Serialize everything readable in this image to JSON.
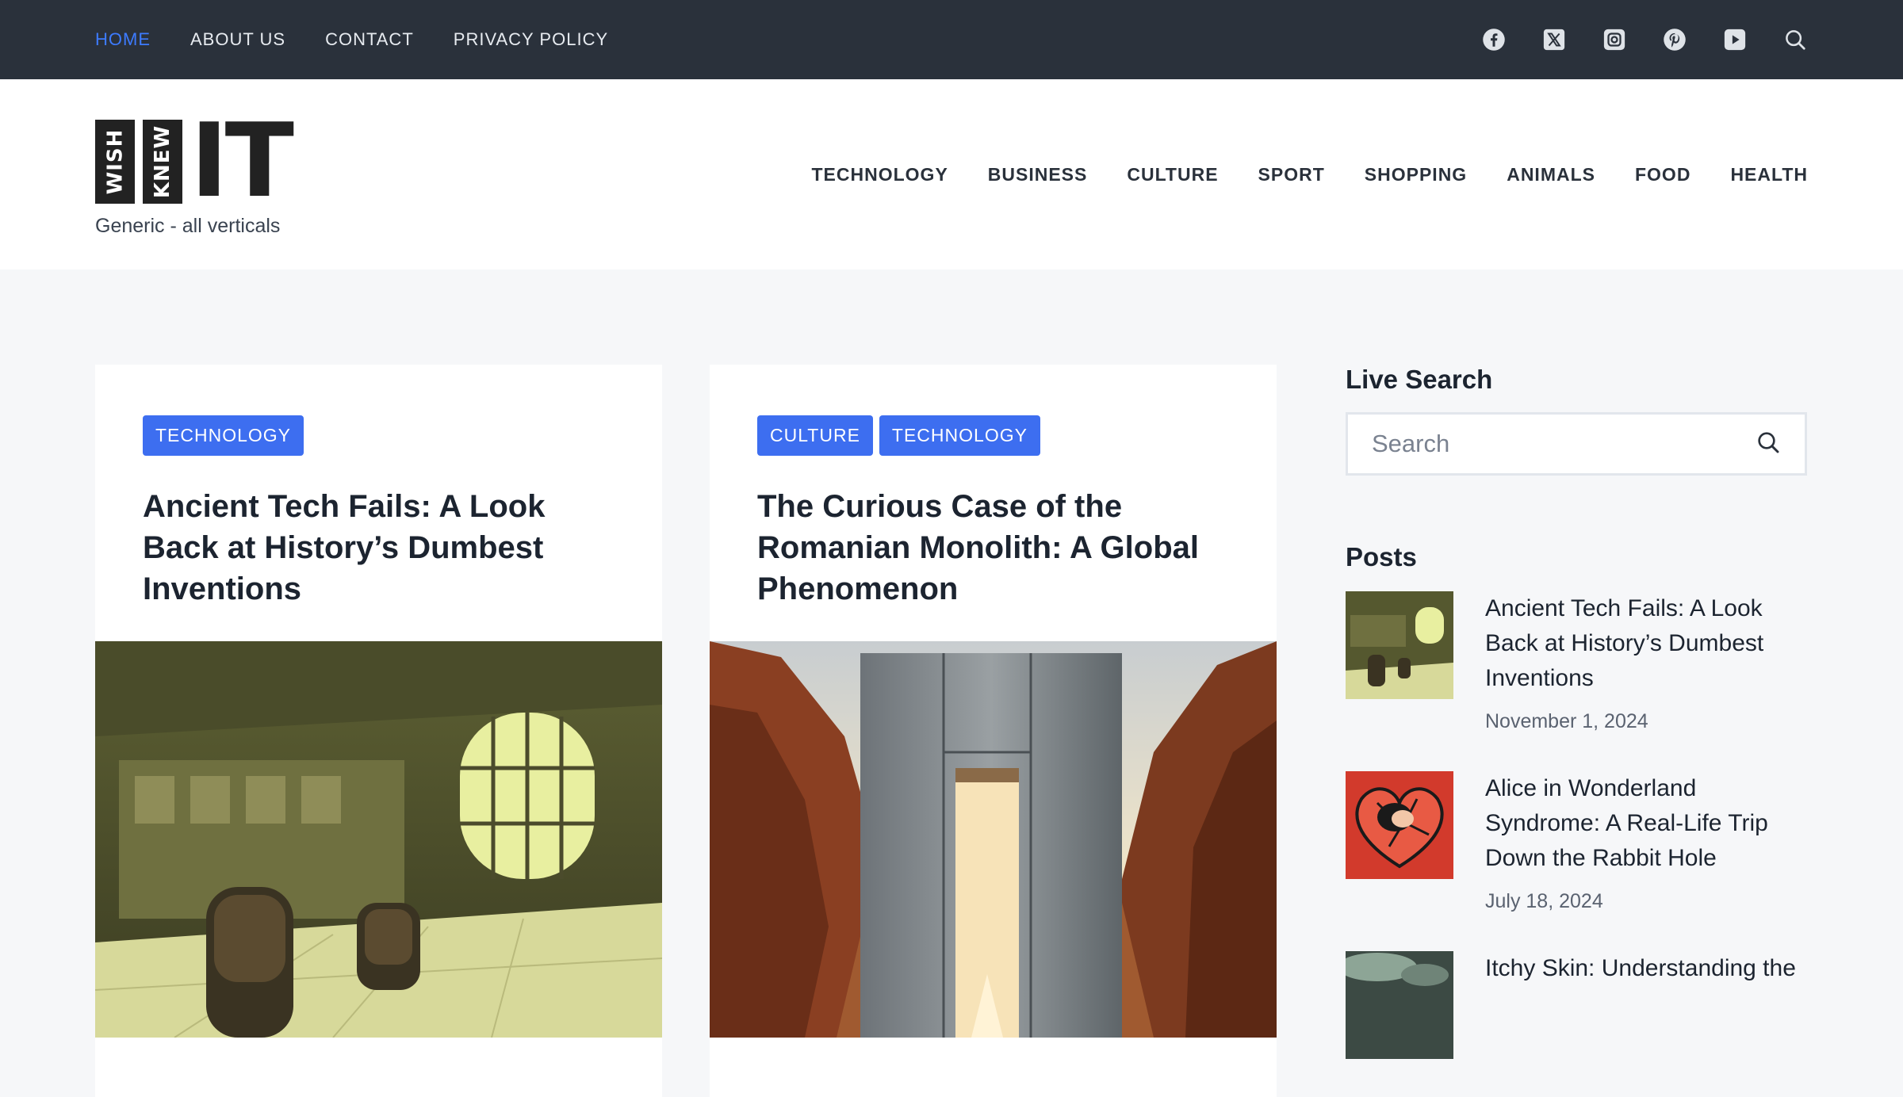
{
  "topbar": {
    "nav": [
      {
        "label": "HOME",
        "active": true
      },
      {
        "label": "ABOUT US",
        "active": false
      },
      {
        "label": "CONTACT",
        "active": false
      },
      {
        "label": "PRIVACY POLICY",
        "active": false
      }
    ],
    "social_icons": [
      "facebook-icon",
      "x-twitter-icon",
      "instagram-icon",
      "pinterest-icon",
      "youtube-icon",
      "search-icon"
    ]
  },
  "brand": {
    "logo_word1": "WISH",
    "logo_word2": "KNEW",
    "logo_word3": "IT",
    "tagline": "Generic - all verticals"
  },
  "main_nav": [
    "TECHNOLOGY",
    "BUSINESS",
    "CULTURE",
    "SPORT",
    "SHOPPING",
    "ANIMALS",
    "FOOD",
    "HEALTH"
  ],
  "articles": [
    {
      "tags": [
        "TECHNOLOGY"
      ],
      "title": "Ancient Tech Fails: A Look Back at History’s Dumbest Inventions"
    },
    {
      "tags": [
        "CULTURE",
        "TECHNOLOGY"
      ],
      "title": "The Curious Case of the Romanian Monolith: A Global Phenomenon"
    }
  ],
  "sidebar": {
    "live_search_heading": "Live Search",
    "search_placeholder": "Search",
    "posts_heading": "Posts",
    "posts": [
      {
        "title": "Ancient Tech Fails: A Look Back at History’s Dumbest Inventions",
        "date": "November 1, 2024"
      },
      {
        "title": "Alice in Wonderland Syndrome: A Real-Life Trip Down the Rabbit Hole",
        "date": "July 18, 2024"
      },
      {
        "title": "Itchy Skin: Understanding the",
        "date": ""
      }
    ]
  },
  "colors": {
    "topbar_bg": "#2a313b",
    "accent": "#3d6ef0",
    "active_link": "#3d7bff",
    "page_bg": "#f6f7f9"
  }
}
